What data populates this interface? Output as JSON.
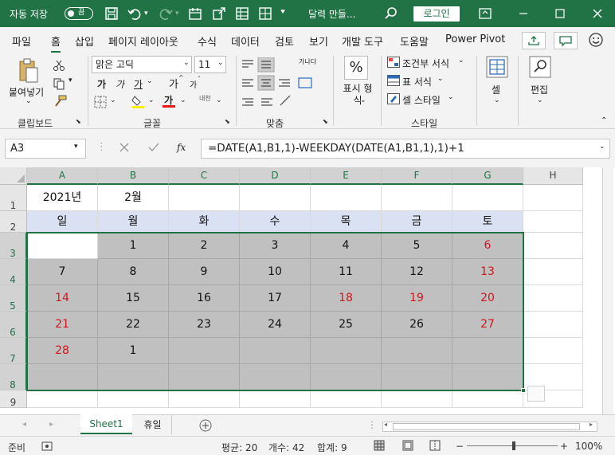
{
  "titlebar": {
    "autosave_label": "자동 저장",
    "autosave_state": "끔",
    "document_title": "달력 만들...",
    "login_label": "로그인"
  },
  "menu": {
    "tabs": [
      "파일",
      "홈",
      "삽입",
      "페이지 레이아웃",
      "수식",
      "데이터",
      "검토",
      "보기",
      "개발 도구",
      "도움말",
      "Power Pivot"
    ],
    "active_tab": "홈"
  },
  "ribbon": {
    "clipboard": {
      "group_label": "클립보드",
      "paste_label": "붙여넣기"
    },
    "font": {
      "group_label": "글꼴",
      "font_name": "맑은 고딕",
      "font_size": "11",
      "bold_label": "가",
      "italic_label": "가",
      "underline_label": "가",
      "grow_label": "가",
      "shrink_label": "가",
      "phonetic_label": "내천"
    },
    "alignment": {
      "group_label": "맞춤",
      "wrap_label": "가나다"
    },
    "number": {
      "format_label": "표시 형식",
      "percent_symbol": "%"
    },
    "styles": {
      "group_label": "스타일",
      "conditional_label": "조건부 서식",
      "table_label": "표 서식",
      "cell_style_label": "셀 스타일"
    },
    "cells": {
      "label": "셀"
    },
    "editing": {
      "label": "편집"
    }
  },
  "formula_bar": {
    "name_box": "A3",
    "formula": "=DATE(A1,B1,1)-WEEKDAY(DATE(A1,B1,1),1)+1",
    "fx_label": "fx"
  },
  "columns": [
    "A",
    "B",
    "C",
    "D",
    "E",
    "F",
    "G",
    "H"
  ],
  "rows": [
    "1",
    "2",
    "3",
    "4",
    "5",
    "6",
    "7",
    "8",
    "9"
  ],
  "cells": {
    "row1": [
      "2021년",
      "2월",
      "",
      "",
      "",
      "",
      ""
    ],
    "row2": [
      "일",
      "월",
      "화",
      "수",
      "목",
      "금",
      "토"
    ],
    "row3": [
      "",
      "1",
      "2",
      "3",
      "4",
      "5",
      "6"
    ],
    "row4": [
      "7",
      "8",
      "9",
      "10",
      "11",
      "12",
      "13"
    ],
    "row5": [
      "14",
      "15",
      "16",
      "17",
      "18",
      "19",
      "20"
    ],
    "row6": [
      "21",
      "22",
      "23",
      "24",
      "25",
      "26",
      "27"
    ],
    "row7": [
      "28",
      "1",
      "",
      "",
      "",
      "",
      ""
    ],
    "row8": [
      "",
      "",
      "",
      "",
      "",
      "",
      ""
    ]
  },
  "red_cells": [
    "r2c0",
    "r2c6",
    "r3c6",
    "r4c0",
    "r4c4",
    "r4c5",
    "r4c6",
    "r5c0",
    "r5c6",
    "r6c0",
    "r6c6",
    "r7c0",
    "r7c1"
  ],
  "colors": {
    "brand_green": "#217346",
    "weekend_red": "#d0151c",
    "header_fill": "#d9e1f2",
    "gray_fill": "#c0c0c0"
  },
  "sheets": {
    "tabs": [
      "Sheet1",
      "휴일"
    ],
    "active": "Sheet1"
  },
  "status": {
    "ready": "준비",
    "average": "평균: 20",
    "count": "개수: 42",
    "sum": "합계: 9",
    "zoom": "100%"
  }
}
